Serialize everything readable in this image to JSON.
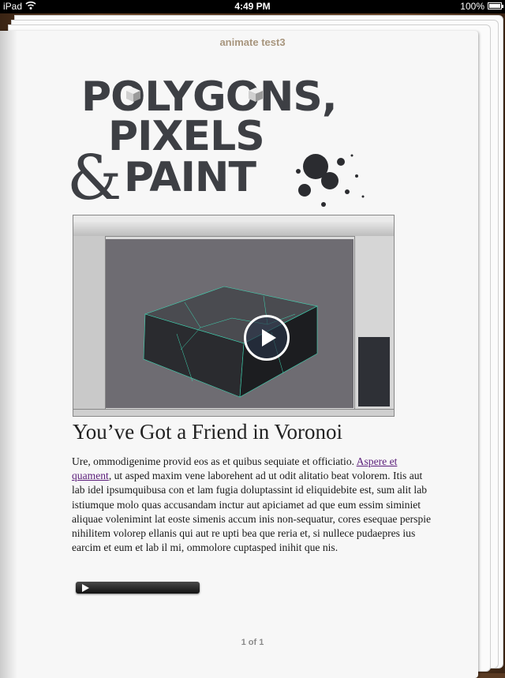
{
  "status_bar": {
    "device": "iPad",
    "time": "4:49 PM",
    "battery": "100%"
  },
  "book": {
    "title": "animate test3",
    "logo": {
      "line1": "POLYGONS,",
      "line2": "PIXELS",
      "ampersand": "&",
      "line3": "PAINT"
    },
    "heading": "You’ve Got a Friend in Voronoi",
    "body_before_link": "Ure, ommodigenime provid eos as et quibus sequiate et officiatio. ",
    "link_text": "Aspere et quament",
    "body_after_link": ", ut asped maxim vene laborehent ad ut odit alitatio beat volorem. Itis aut lab idel ipsumquibusa con et lam fugia doluptassint id eliquidebite est, sum alit lab istiumque molo quas accusandam inctur aut apiciamet ad que eum essim siminiet aliquae volenimint lat eoste simenis accum inis non-sequatur, cores esequae perspie nihilitem volorep ellanis qui aut re upti bea que reria et, si nullece pudaepres ius earcim et eum et lab il mi, ommolore cuptasped inihit que nis.",
    "page_indicator": "1 of 1"
  },
  "colors": {
    "title": "#a8967e",
    "logo": "#3d3f44",
    "link": "#5a1d7a",
    "viewport": "#6e6c72",
    "wireframe": "#3fd8b4"
  }
}
